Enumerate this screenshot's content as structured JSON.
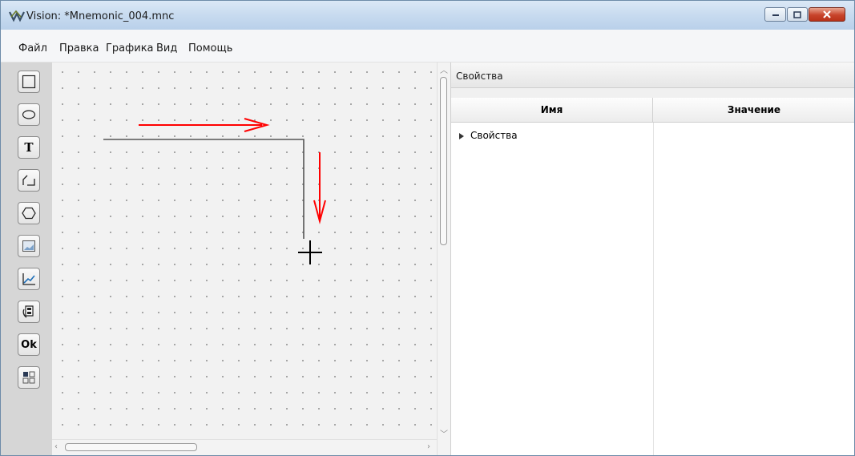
{
  "window": {
    "title": "Vision: *Mnemonic_004.mnc"
  },
  "menu": {
    "items": [
      "Файл",
      "Правка",
      "Графика",
      "Вид",
      "Помощь"
    ]
  },
  "toolbox": {
    "tools": [
      {
        "name": "rectangle-icon"
      },
      {
        "name": "ellipse-icon"
      },
      {
        "name": "text-icon",
        "label": "T"
      },
      {
        "name": "polyline-icon"
      },
      {
        "name": "polygon-icon"
      },
      {
        "name": "image-icon"
      },
      {
        "name": "chart-icon"
      },
      {
        "name": "document-icon"
      },
      {
        "name": "button-icon",
        "label": "Ok"
      },
      {
        "name": "widget-icon"
      }
    ]
  },
  "properties": {
    "panel_title": "Свойства",
    "columns": [
      "Имя",
      "Значение"
    ],
    "rows": [
      {
        "name": "Свойства",
        "value": ""
      }
    ]
  },
  "colors": {
    "annotation_arrow": "#ff0000",
    "drawn_line": "#555555",
    "cursor": "#000000"
  }
}
